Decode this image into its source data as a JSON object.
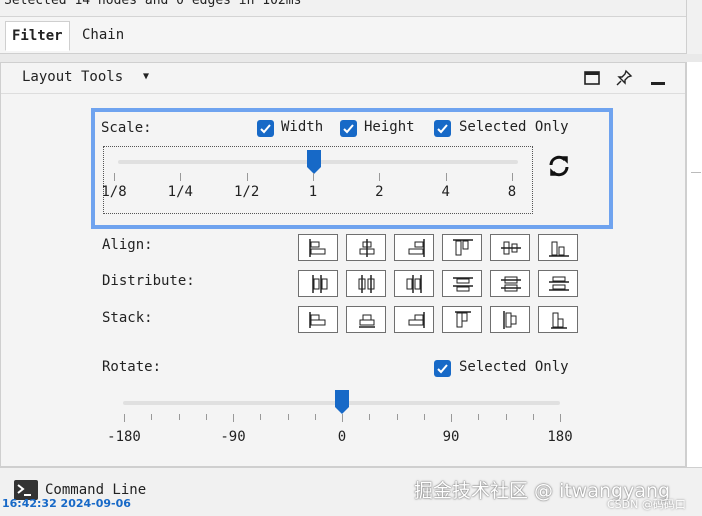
{
  "status": {
    "text": "Selected 14 nodes and 0 edges in 102ms"
  },
  "tabs": [
    {
      "label": "Filter",
      "selected": true
    },
    {
      "label": "Chain",
      "selected": false
    }
  ],
  "panel": {
    "title": "Layout Tools",
    "header_icons": [
      "maximize-icon",
      "pin-icon",
      "minimize-icon"
    ]
  },
  "scale": {
    "label": "Scale:",
    "checkboxes": [
      {
        "label": "Width",
        "checked": true
      },
      {
        "label": "Height",
        "checked": true
      },
      {
        "label": "Selected Only",
        "checked": true
      }
    ],
    "ticks": [
      "1/8",
      "1/4",
      "1/2",
      "1",
      "2",
      "4",
      "8"
    ],
    "value": "1",
    "reset_icon": "refresh-icon"
  },
  "align": {
    "label": "Align:",
    "buttons": [
      "align-left-icon",
      "align-center-icon",
      "align-right-icon",
      "align-top-icon",
      "align-middle-icon",
      "align-bottom-icon"
    ]
  },
  "distribute": {
    "label": "Distribute:",
    "buttons": [
      "distribute-left-icon",
      "distribute-center-icon",
      "distribute-right-icon",
      "distribute-top-icon",
      "distribute-middle-icon",
      "distribute-bottom-icon"
    ]
  },
  "stack": {
    "label": "Stack:",
    "buttons": [
      "stack-vertical-left-icon",
      "stack-vertical-center-icon",
      "stack-vertical-right-icon",
      "stack-horizontal-top-icon",
      "stack-horizontal-center-icon",
      "stack-horizontal-bottom-icon"
    ]
  },
  "rotate": {
    "label": "Rotate:",
    "selected_only": {
      "label": "Selected Only",
      "checked": true
    },
    "ticks": [
      "-180",
      "-90",
      "0",
      "90",
      "180"
    ],
    "value": 0
  },
  "command_line": {
    "label": "Command Line"
  },
  "overlay": {
    "timestamp": "16:42:32 2024-09-06",
    "watermark": "掘金技术社区 @ itwangyang",
    "watermark_small": "CSDN @码码口"
  }
}
